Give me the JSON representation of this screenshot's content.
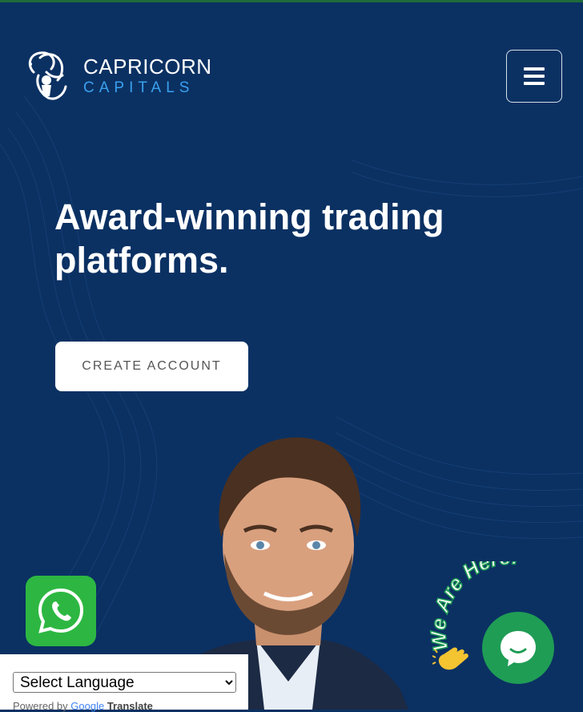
{
  "brand": {
    "name_top": "CAPRICORN",
    "name_bottom": "CAPITALS",
    "logo_icon": "capricorn-goat-icon"
  },
  "header": {
    "menu_icon": "hamburger-menu-icon"
  },
  "hero": {
    "headline": "Award-winning trading platforms.",
    "cta_label": "CREATE ACCOUNT"
  },
  "whatsapp": {
    "icon": "whatsapp-icon"
  },
  "language": {
    "selected": "Select Language",
    "powered_by": "Powered by",
    "google": "Google",
    "translate": "Translate"
  },
  "chat": {
    "badge_text": "We Are Here!",
    "icon": "chat-bubble-icon",
    "hand_icon": "waving-hand-icon"
  },
  "colors": {
    "background": "#0b3163",
    "brand_accent": "#3aa0ee",
    "whatsapp": "#2db742",
    "chat": "#1f9d55"
  }
}
